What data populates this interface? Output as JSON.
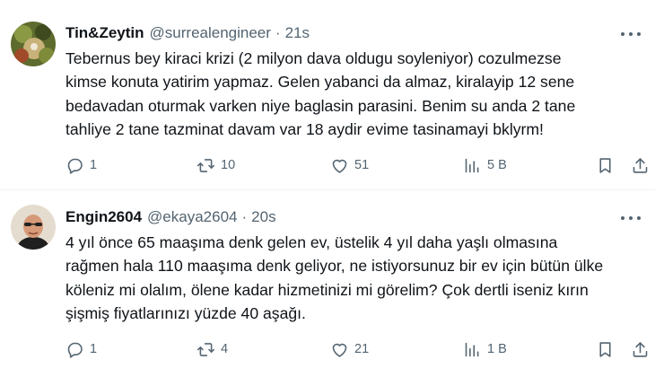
{
  "tweets": [
    {
      "name": "Tin&Zeytin",
      "handle": "@surrealengineer",
      "separator": "·",
      "time": "21s",
      "lines": [
        "Tebernus bey kiraci krizi (2 milyon dava oldugu soyleniyor) cozulmezse",
        "kimse konuta yatirim yapmaz.  Gelen yabanci da almaz, kiralayip 12 sene",
        "bedavadan oturmak varken niye baglasin parasini. Benim su anda 2 tane",
        "tahliye 2 tane tazminat davam var 18 aydir evime tasinamayi bklyrm!"
      ],
      "replies": "1",
      "retweets": "10",
      "likes": "51",
      "views": "5 B",
      "colors": {
        "avatar_bg": "#6f7d3a",
        "avatar_accent": "#c9b27a"
      }
    },
    {
      "name": "Engin2604",
      "handle": "@ekaya2604",
      "separator": "·",
      "time": "20s",
      "lines": [
        "4 yıl önce 65 maaşıma denk gelen ev, üstelik 4 yıl daha yaşlı olmasına",
        "rağmen hala 110 maaşıma denk geliyor, ne istiyorsunuz bir ev için bütün ülke",
        "köleniz mi olalım, ölene kadar hizmetinizi mi görelim? Çok dertli iseniz kırın",
        "şişmiş fiyatlarınızı yüzde 40 aşağı."
      ],
      "replies": "1",
      "retweets": "4",
      "likes": "21",
      "views": "1 B",
      "colors": {
        "avatar_bg": "#d9c9b5",
        "avatar_accent": "#c88d6c"
      }
    }
  ],
  "icons": {
    "reply": "reply-icon",
    "retweet": "retweet-icon",
    "like": "like-icon",
    "views": "views-icon",
    "bookmark": "bookmark-icon",
    "share": "share-icon",
    "more": "more-icon"
  },
  "colors": {
    "text": "#0f1419",
    "secondary": "#536471",
    "divider": "#eff3f4"
  }
}
